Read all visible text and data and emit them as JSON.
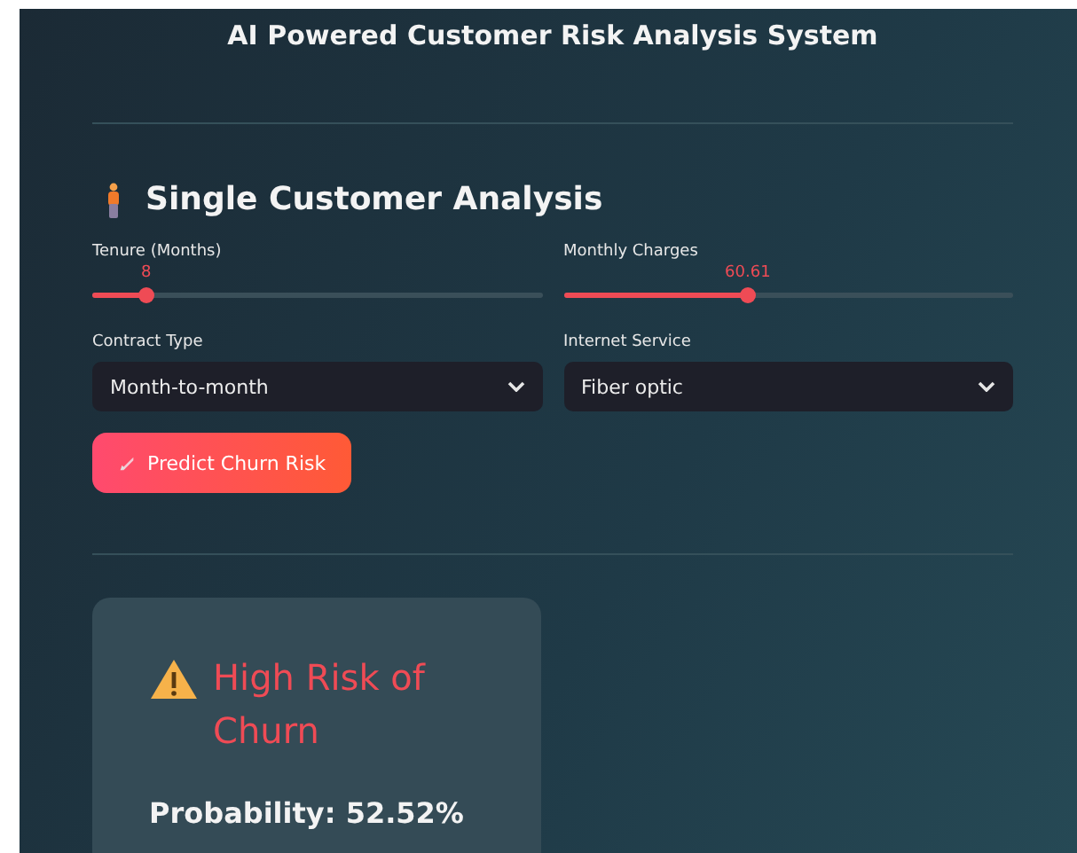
{
  "title": "AI Powered Customer Risk Analysis System",
  "section": {
    "title": "Single Customer Analysis"
  },
  "sliders": [
    {
      "label": "Tenure (Months)",
      "reading": "8",
      "level": 0.12
    },
    {
      "label": "Monthly Charges",
      "reading": "60.61",
      "level": 0.41
    }
  ],
  "selects": [
    {
      "label": "Contract Type",
      "value": "Month-to-month"
    },
    {
      "label": "Internet Service",
      "value": "Fiber optic"
    }
  ],
  "button": {
    "label": "Predict Churn Risk"
  },
  "result": {
    "warning": true,
    "headline": "High Risk of Churn",
    "probability": "Probability: 52.52%"
  }
}
